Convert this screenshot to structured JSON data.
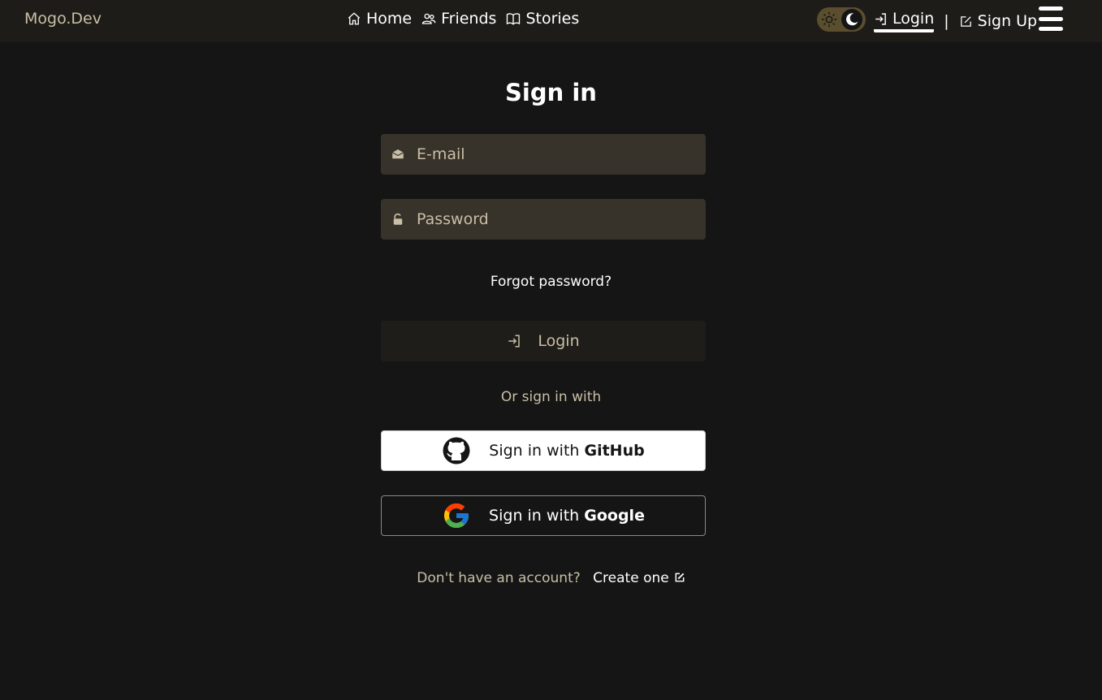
{
  "header": {
    "brand": "Mogo.Dev",
    "nav": [
      {
        "label": "Home",
        "icon": "home-icon"
      },
      {
        "label": "Friends",
        "icon": "friends-icon"
      },
      {
        "label": "Stories",
        "icon": "book-icon"
      }
    ],
    "login_label": "Login",
    "separator": "|",
    "signup_label": "Sign Up"
  },
  "form": {
    "title": "Sign in",
    "email_placeholder": "E-mail",
    "password_placeholder": "Password",
    "forgot_label": "Forgot password?",
    "login_button": "Login",
    "or_text": "Or sign in with",
    "github_prefix": "Sign in with ",
    "github_brand": "GitHub",
    "google_prefix": "Sign in with ",
    "google_brand": "Google",
    "no_account": "Don't have an account?",
    "create_label": "Create one"
  },
  "colors": {
    "background": "#151515",
    "topbar": "#1e1c18",
    "field": "#37322a",
    "muted_text": "#c9bfa6"
  }
}
